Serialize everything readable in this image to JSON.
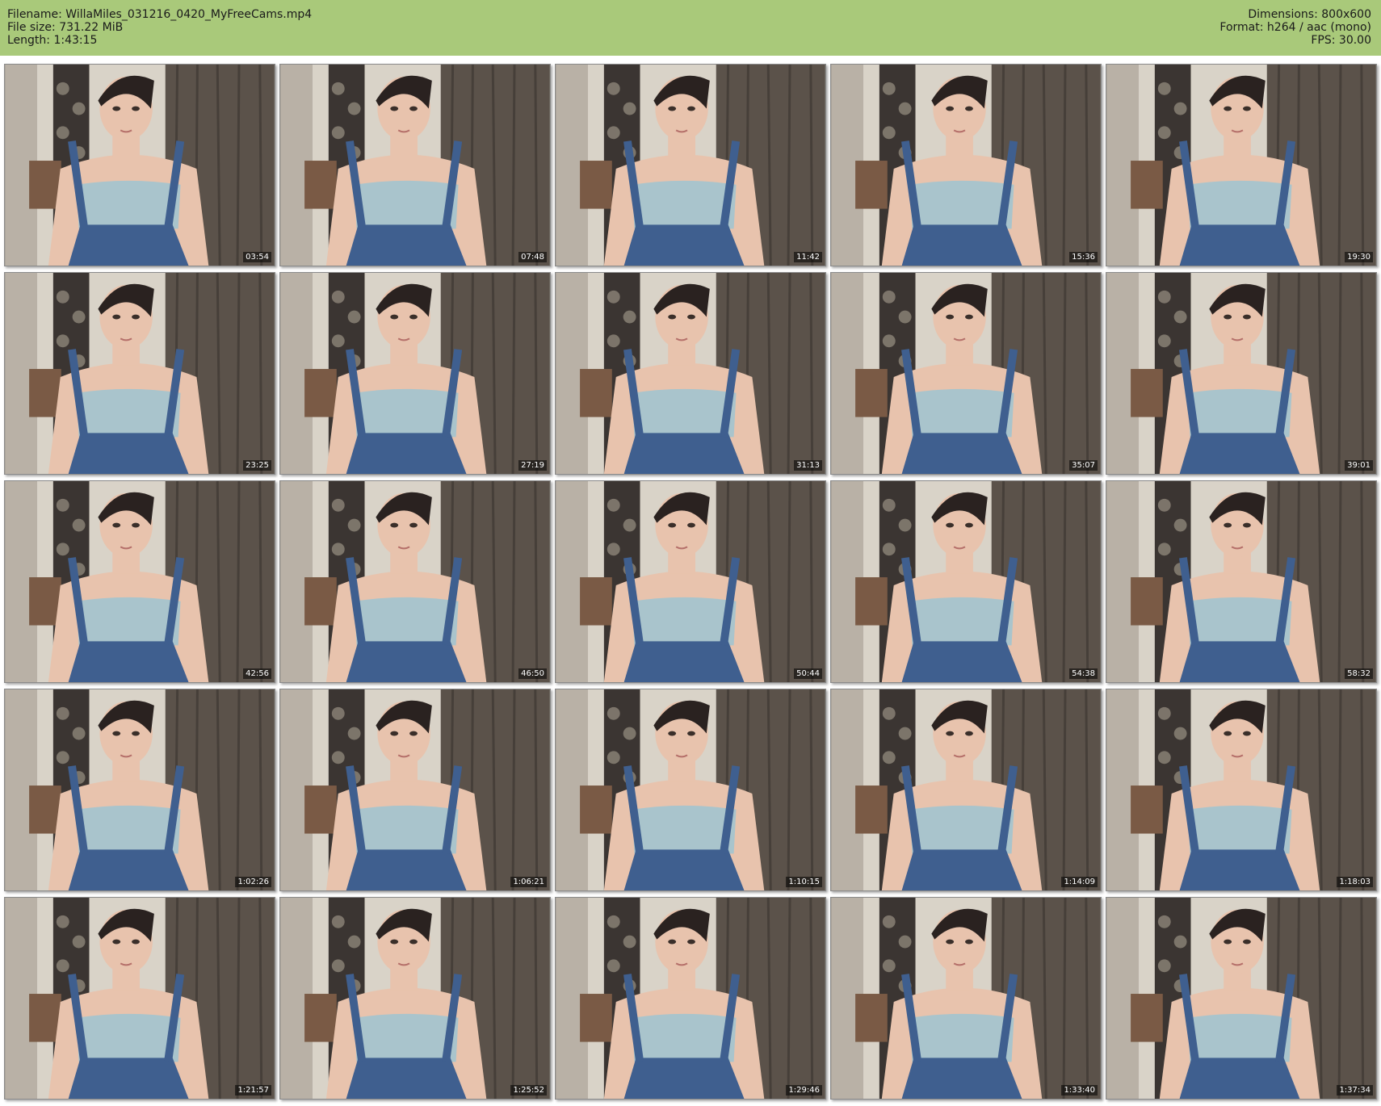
{
  "header": {
    "filename": "Filename: WillaMiles_031216_0420_MyFreeCams.mp4",
    "filesize": "File size: 731.22 MiB",
    "length": "Length: 1:43:15",
    "dimensions": "Dimensions: 800x600",
    "format": "Format: h264 / aac (mono)",
    "fps": "FPS: 30.00"
  },
  "thumbnails": [
    {
      "timestamp": "03:54"
    },
    {
      "timestamp": "07:48"
    },
    {
      "timestamp": "11:42"
    },
    {
      "timestamp": "15:36"
    },
    {
      "timestamp": "19:30"
    },
    {
      "timestamp": "23:25"
    },
    {
      "timestamp": "27:19"
    },
    {
      "timestamp": "31:13"
    },
    {
      "timestamp": "35:07"
    },
    {
      "timestamp": "39:01"
    },
    {
      "timestamp": "42:56"
    },
    {
      "timestamp": "46:50"
    },
    {
      "timestamp": "50:44"
    },
    {
      "timestamp": "54:38"
    },
    {
      "timestamp": "58:32"
    },
    {
      "timestamp": "1:02:26"
    },
    {
      "timestamp": "1:06:21"
    },
    {
      "timestamp": "1:10:15"
    },
    {
      "timestamp": "1:14:09"
    },
    {
      "timestamp": "1:18:03"
    },
    {
      "timestamp": "1:21:57"
    },
    {
      "timestamp": "1:25:52"
    },
    {
      "timestamp": "1:29:46"
    },
    {
      "timestamp": "1:33:40"
    },
    {
      "timestamp": "1:37:34"
    }
  ],
  "colors": {
    "header_bg": "#a9c97a",
    "wall": "#d9d3c8",
    "curtain": "#5b524a",
    "skin": "#e8c3ad",
    "top": "#a9c4cc",
    "denim": "#3f5f8f",
    "hair": "#2a2220"
  }
}
